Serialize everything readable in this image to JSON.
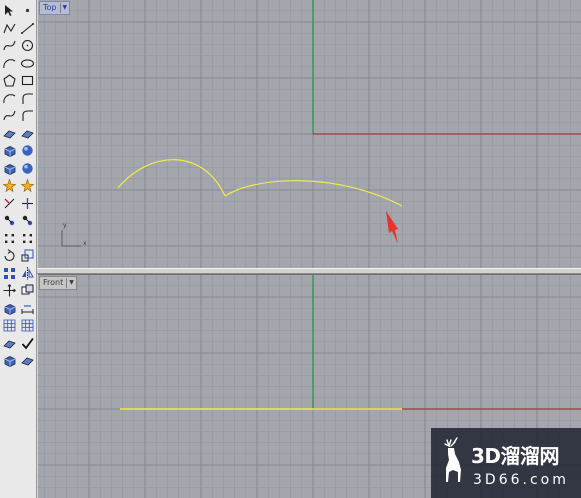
{
  "toolbar": {
    "tools": [
      {
        "name": "select-arrow-icon",
        "symbol": "arrow"
      },
      {
        "name": "point-icon",
        "symbol": "dot"
      },
      {
        "name": "polyline-icon",
        "symbol": "polyline"
      },
      {
        "name": "line-icon",
        "symbol": "line"
      },
      {
        "name": "freeform-curve-icon",
        "symbol": "curve"
      },
      {
        "name": "circle-icon",
        "symbol": "circle"
      },
      {
        "name": "arc-icon",
        "symbol": "arc"
      },
      {
        "name": "ellipse-icon",
        "symbol": "ellipse"
      },
      {
        "name": "polygon-icon",
        "symbol": "polygon"
      },
      {
        "name": "rectangle-icon",
        "symbol": "rect"
      },
      {
        "name": "arc-three-point-icon",
        "symbol": "arc"
      },
      {
        "name": "fillet-icon",
        "symbol": "fillet"
      },
      {
        "name": "curve-offset-icon",
        "symbol": "curve"
      },
      {
        "name": "fillet-curves-icon",
        "symbol": "fillet"
      },
      {
        "name": "surface-from-curves-icon",
        "symbol": "surface"
      },
      {
        "name": "extrude-surface-icon",
        "symbol": "surface"
      },
      {
        "name": "solid-box-icon",
        "symbol": "box"
      },
      {
        "name": "solid-sphere-icon",
        "symbol": "sphere"
      },
      {
        "name": "mesh-box-icon",
        "symbol": "box"
      },
      {
        "name": "boolean-union-icon",
        "symbol": "sphere"
      },
      {
        "name": "explode-icon",
        "symbol": "spark"
      },
      {
        "name": "join-icon",
        "symbol": "spark"
      },
      {
        "name": "trim-icon",
        "symbol": "trim"
      },
      {
        "name": "split-icon",
        "symbol": "split"
      },
      {
        "name": "group-icon",
        "symbol": "group"
      },
      {
        "name": "ungroup-icon",
        "symbol": "group"
      },
      {
        "name": "point-edit-icon",
        "symbol": "dots"
      },
      {
        "name": "control-points-icon",
        "symbol": "dots"
      },
      {
        "name": "rotate-icon",
        "symbol": "rotate"
      },
      {
        "name": "scale-icon",
        "symbol": "scale"
      },
      {
        "name": "array-icon",
        "symbol": "array"
      },
      {
        "name": "mirror-icon",
        "symbol": "mirror"
      },
      {
        "name": "move-icon",
        "symbol": "move"
      },
      {
        "name": "copy-icon",
        "symbol": "copy"
      },
      {
        "name": "analyze-icon",
        "symbol": "box"
      },
      {
        "name": "dimension-icon",
        "symbol": "dim"
      },
      {
        "name": "grid-snap-icon",
        "symbol": "grid"
      },
      {
        "name": "grid-options-icon",
        "symbol": "grid"
      },
      {
        "name": "render-icon",
        "symbol": "surface"
      },
      {
        "name": "check-icon",
        "symbol": "check"
      },
      {
        "name": "layer-icon",
        "symbol": "box"
      },
      {
        "name": "material-icon",
        "symbol": "surface"
      }
    ]
  },
  "viewports": {
    "top": {
      "label": "Top",
      "axis_y": "y",
      "axis_x": "x"
    },
    "front": {
      "label": "Front"
    }
  },
  "watermark": {
    "title": "3D溜溜网",
    "url": "3D66.com"
  },
  "colors": {
    "grid_background": "#a3a6ad",
    "grid_line": "#8f939b",
    "grid_major": "#7c8089",
    "curve": "#f0eb4a",
    "x_axis": "#9e3b36",
    "y_axis": "#2e8a36",
    "pointer": "#e8332b"
  }
}
